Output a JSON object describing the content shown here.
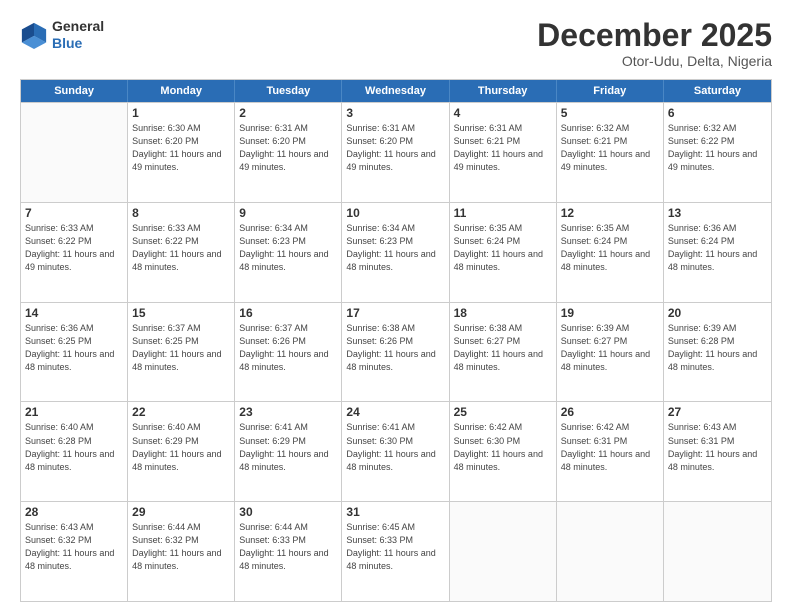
{
  "header": {
    "logo_line1": "General",
    "logo_line2": "Blue",
    "month": "December 2025",
    "location": "Otor-Udu, Delta, Nigeria"
  },
  "weekdays": [
    "Sunday",
    "Monday",
    "Tuesday",
    "Wednesday",
    "Thursday",
    "Friday",
    "Saturday"
  ],
  "weeks": [
    [
      {
        "day": "",
        "sunrise": "",
        "sunset": "",
        "daylight": ""
      },
      {
        "day": "1",
        "sunrise": "6:30 AM",
        "sunset": "6:20 PM",
        "daylight": "11 hours and 49 minutes."
      },
      {
        "day": "2",
        "sunrise": "6:31 AM",
        "sunset": "6:20 PM",
        "daylight": "11 hours and 49 minutes."
      },
      {
        "day": "3",
        "sunrise": "6:31 AM",
        "sunset": "6:20 PM",
        "daylight": "11 hours and 49 minutes."
      },
      {
        "day": "4",
        "sunrise": "6:31 AM",
        "sunset": "6:21 PM",
        "daylight": "11 hours and 49 minutes."
      },
      {
        "day": "5",
        "sunrise": "6:32 AM",
        "sunset": "6:21 PM",
        "daylight": "11 hours and 49 minutes."
      },
      {
        "day": "6",
        "sunrise": "6:32 AM",
        "sunset": "6:22 PM",
        "daylight": "11 hours and 49 minutes."
      }
    ],
    [
      {
        "day": "7",
        "sunrise": "6:33 AM",
        "sunset": "6:22 PM",
        "daylight": "11 hours and 49 minutes."
      },
      {
        "day": "8",
        "sunrise": "6:33 AM",
        "sunset": "6:22 PM",
        "daylight": "11 hours and 48 minutes."
      },
      {
        "day": "9",
        "sunrise": "6:34 AM",
        "sunset": "6:23 PM",
        "daylight": "11 hours and 48 minutes."
      },
      {
        "day": "10",
        "sunrise": "6:34 AM",
        "sunset": "6:23 PM",
        "daylight": "11 hours and 48 minutes."
      },
      {
        "day": "11",
        "sunrise": "6:35 AM",
        "sunset": "6:24 PM",
        "daylight": "11 hours and 48 minutes."
      },
      {
        "day": "12",
        "sunrise": "6:35 AM",
        "sunset": "6:24 PM",
        "daylight": "11 hours and 48 minutes."
      },
      {
        "day": "13",
        "sunrise": "6:36 AM",
        "sunset": "6:24 PM",
        "daylight": "11 hours and 48 minutes."
      }
    ],
    [
      {
        "day": "14",
        "sunrise": "6:36 AM",
        "sunset": "6:25 PM",
        "daylight": "11 hours and 48 minutes."
      },
      {
        "day": "15",
        "sunrise": "6:37 AM",
        "sunset": "6:25 PM",
        "daylight": "11 hours and 48 minutes."
      },
      {
        "day": "16",
        "sunrise": "6:37 AM",
        "sunset": "6:26 PM",
        "daylight": "11 hours and 48 minutes."
      },
      {
        "day": "17",
        "sunrise": "6:38 AM",
        "sunset": "6:26 PM",
        "daylight": "11 hours and 48 minutes."
      },
      {
        "day": "18",
        "sunrise": "6:38 AM",
        "sunset": "6:27 PM",
        "daylight": "11 hours and 48 minutes."
      },
      {
        "day": "19",
        "sunrise": "6:39 AM",
        "sunset": "6:27 PM",
        "daylight": "11 hours and 48 minutes."
      },
      {
        "day": "20",
        "sunrise": "6:39 AM",
        "sunset": "6:28 PM",
        "daylight": "11 hours and 48 minutes."
      }
    ],
    [
      {
        "day": "21",
        "sunrise": "6:40 AM",
        "sunset": "6:28 PM",
        "daylight": "11 hours and 48 minutes."
      },
      {
        "day": "22",
        "sunrise": "6:40 AM",
        "sunset": "6:29 PM",
        "daylight": "11 hours and 48 minutes."
      },
      {
        "day": "23",
        "sunrise": "6:41 AM",
        "sunset": "6:29 PM",
        "daylight": "11 hours and 48 minutes."
      },
      {
        "day": "24",
        "sunrise": "6:41 AM",
        "sunset": "6:30 PM",
        "daylight": "11 hours and 48 minutes."
      },
      {
        "day": "25",
        "sunrise": "6:42 AM",
        "sunset": "6:30 PM",
        "daylight": "11 hours and 48 minutes."
      },
      {
        "day": "26",
        "sunrise": "6:42 AM",
        "sunset": "6:31 PM",
        "daylight": "11 hours and 48 minutes."
      },
      {
        "day": "27",
        "sunrise": "6:43 AM",
        "sunset": "6:31 PM",
        "daylight": "11 hours and 48 minutes."
      }
    ],
    [
      {
        "day": "28",
        "sunrise": "6:43 AM",
        "sunset": "6:32 PM",
        "daylight": "11 hours and 48 minutes."
      },
      {
        "day": "29",
        "sunrise": "6:44 AM",
        "sunset": "6:32 PM",
        "daylight": "11 hours and 48 minutes."
      },
      {
        "day": "30",
        "sunrise": "6:44 AM",
        "sunset": "6:33 PM",
        "daylight": "11 hours and 48 minutes."
      },
      {
        "day": "31",
        "sunrise": "6:45 AM",
        "sunset": "6:33 PM",
        "daylight": "11 hours and 48 minutes."
      },
      {
        "day": "",
        "sunrise": "",
        "sunset": "",
        "daylight": ""
      },
      {
        "day": "",
        "sunrise": "",
        "sunset": "",
        "daylight": ""
      },
      {
        "day": "",
        "sunrise": "",
        "sunset": "",
        "daylight": ""
      }
    ]
  ]
}
